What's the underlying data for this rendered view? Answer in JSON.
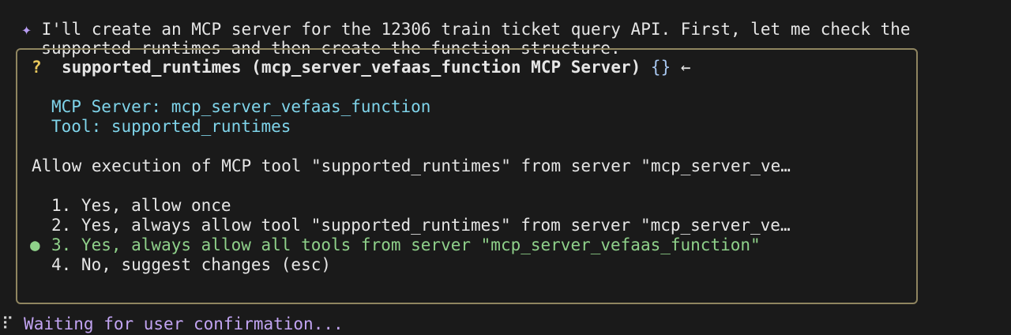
{
  "assistant": {
    "icon": "sparkle-icon",
    "line1": "I'll create an MCP server for the 12306 train ticket query API. First, let me check the",
    "line2": "supported runtimes and then create the function structure."
  },
  "dialog": {
    "question_mark": "?",
    "title": "supported_runtimes (mcp_server_vefaas_function MCP Server)",
    "braces": "{}",
    "arrow": "←",
    "server_line": "MCP Server: mcp_server_vefaas_function",
    "tool_line": "Tool: supported_runtimes",
    "prompt": "Allow execution of MCP tool \"supported_runtimes\" from server \"mcp_server_ve…",
    "selected_marker": "●",
    "options": [
      {
        "label": "1. Yes, allow once"
      },
      {
        "label": "2. Yes, always allow tool \"supported_runtimes\" from server \"mcp_server_ve…"
      },
      {
        "label": "3. Yes, always allow all tools from server \"mcp_server_vefaas_function\""
      },
      {
        "label": "4. No, suggest changes (esc)"
      }
    ],
    "selected_index": 2
  },
  "status": {
    "spinner": "⠏",
    "text": "Waiting for user confirmation..."
  },
  "colors": {
    "background": "#1a1a1a",
    "border": "#8f8560",
    "accent_green": "#8fd18a",
    "accent_cyan": "#7fd4ea",
    "accent_purple": "#c2a4f2"
  }
}
